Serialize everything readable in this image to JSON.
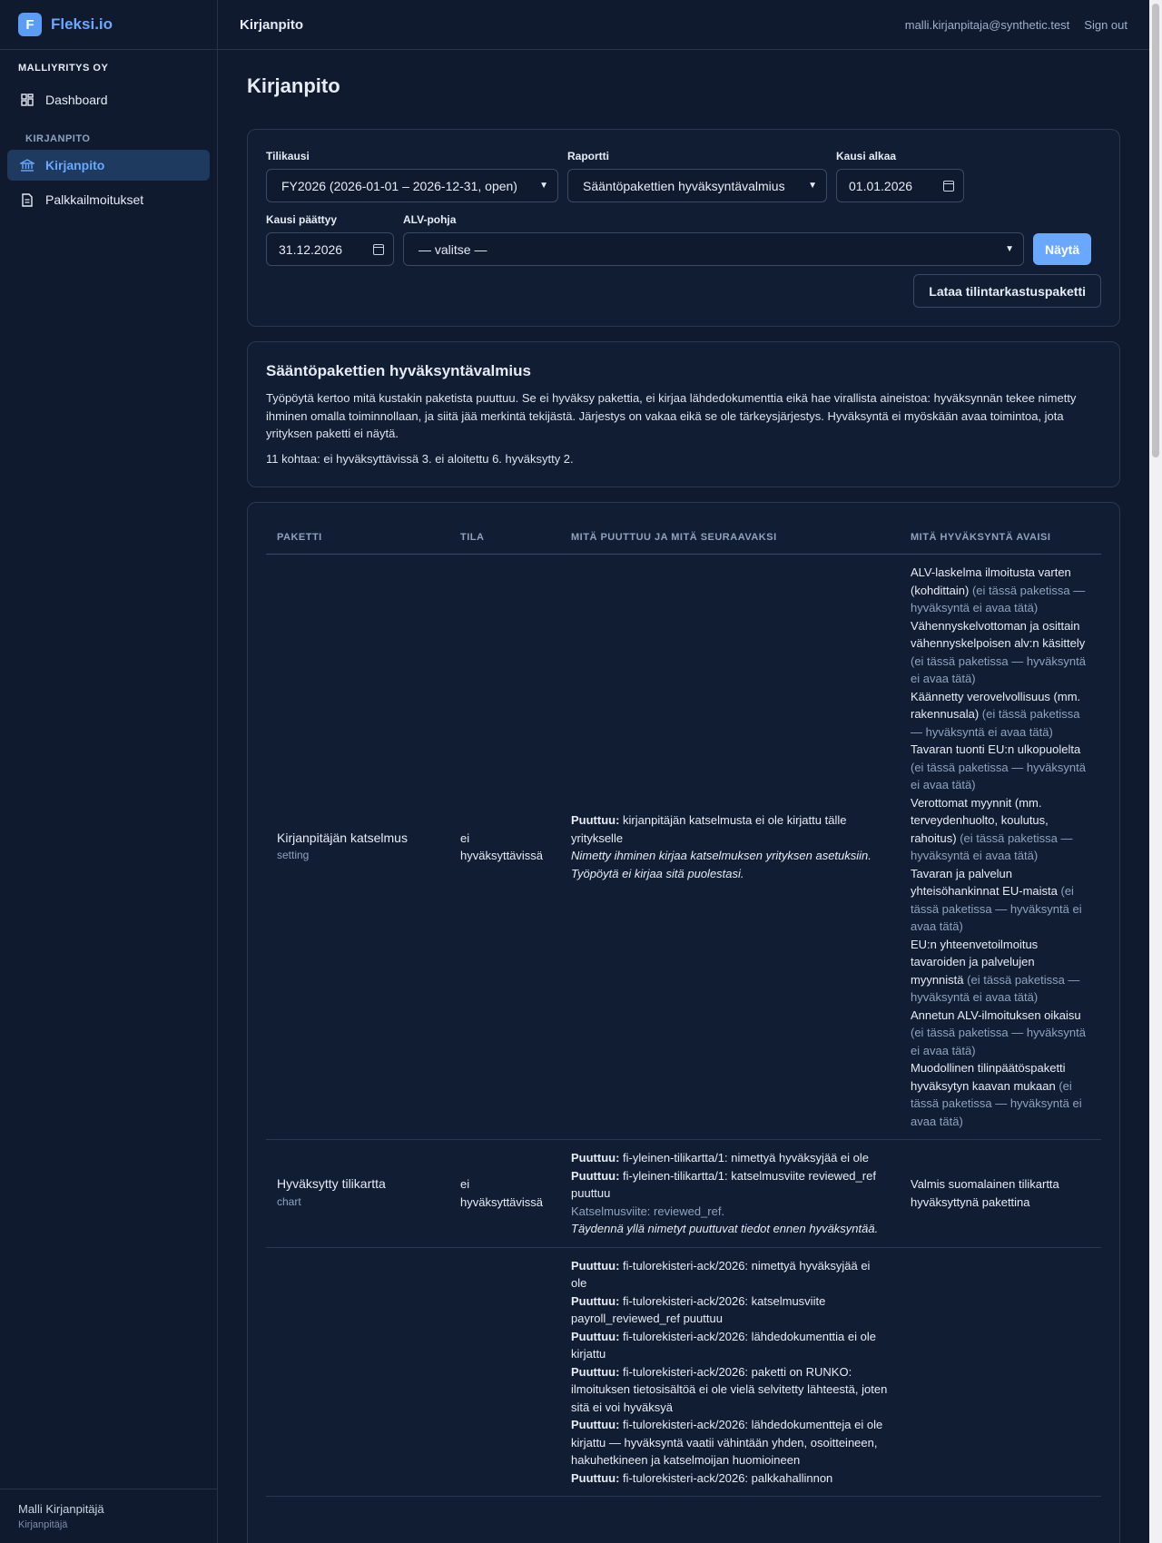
{
  "brand": {
    "logo_letter": "F",
    "name": "Fleksi.io"
  },
  "sidebar": {
    "company": "MALLIYRITYS OY",
    "dashboard_label": "Dashboard",
    "section_label": "KIRJANPITO",
    "items": [
      {
        "label": "Kirjanpito",
        "icon": "bank-icon",
        "active": true
      },
      {
        "label": "Palkkailmoitukset",
        "icon": "document-icon",
        "active": false
      }
    ],
    "user": {
      "name": "Malli Kirjanpitäjä",
      "role": "Kirjanpitäjä"
    }
  },
  "topbar": {
    "title": "Kirjanpito",
    "email": "malli.kirjanpitaja@synthetic.test",
    "signout": "Sign out"
  },
  "page": {
    "title": "Kirjanpito"
  },
  "filters": {
    "period_label": "Tilikausi",
    "period_value": "FY2026 (2026-01-01 – 2026-12-31, open)",
    "report_label": "Raportti",
    "report_value": "Sääntöpakettien hyväksyntävalmius",
    "start_label": "Kausi alkaa",
    "start_value": "01.01.2026",
    "end_label": "Kausi päättyy",
    "end_value": "31.12.2026",
    "vat_label": "ALV-pohja",
    "vat_value": "— valitse —",
    "show_button": "Näytä",
    "download_button": "Lataa tilintarkastuspaketti"
  },
  "info": {
    "title": "Sääntöpakettien hyväksyntävalmius",
    "description": "Työpöytä kertoo mitä kustakin paketista puuttuu. Se ei hyväksy pakettia, ei kirjaa lähdedokumenttia eikä hae virallista aineistoa: hyväksynnän tekee nimetty ihminen omalla toiminnollaan, ja siitä jää merkintä tekijästä. Järjestys on vakaa eikä se ole tärkeysjärjestys. Hyväksyntä ei myöskään avaa toimintoa, jota yrityksen paketti ei näytä.",
    "summary": "11 kohtaa: ei hyväksyttävissä 3. ei aloitettu 6. hyväksytty 2."
  },
  "table": {
    "headers": [
      "PAKETTI",
      "TILA",
      "MITÄ PUUTTUU JA MITÄ SEURAAVAKSI",
      "MITÄ HYVÄKSYNTÄ AVAISI"
    ],
    "missing_prefix": "Puuttuu:",
    "not_in_package": "(ei tässä paketissa — hyväksyntä ei avaa tätä)",
    "rows": [
      {
        "name": "Kirjanpitäjän katselmus",
        "kind": "setting",
        "status": "ei hyväksyttävissä",
        "missing": [
          "kirjanpitäjän katselmusta ei ole kirjattu tälle yritykselle"
        ],
        "ref": "",
        "note": "Nimetty ihminen kirjaa katselmuksen yrityksen asetuksiin. Työpöytä ei kirjaa sitä puolestasi.",
        "opens": [
          "ALV-laskelma ilmoitusta varten (kohdittain)",
          "Vähennyskelvottoman ja osittain vähennyskelpoisen alv:n käsittely",
          "Käännetty verovelvollisuus (mm. rakennusala)",
          "Tavaran tuonti EU:n ulkopuolelta",
          "Verottomat myynnit (mm. terveydenhuolto, koulutus, rahoitus)",
          "Tavaran ja palvelun yhteisöhankinnat EU-maista",
          "EU:n yhteenvetoilmoitus tavaroiden ja palvelujen myynnistä",
          "Annetun ALV-ilmoituksen oikaisu",
          "Muodollinen tilinpäätöspaketti hyväksytyn kaavan mukaan"
        ]
      },
      {
        "name": "Hyväksytty tilikartta",
        "kind": "chart",
        "status": "ei hyväksyttävissä",
        "missing": [
          "fi-yleinen-tilikartta/1: nimettyä hyväksyjää ei ole",
          "fi-yleinen-tilikartta/1: katselmusviite reviewed_ref puuttuu"
        ],
        "ref": "Katselmusviite: reviewed_ref.",
        "note": "Täydennä yllä nimetyt puuttuvat tiedot ennen hyväksyntää.",
        "opens_plain": "Valmis suomalainen tilikartta hyväksyttynä pakettina"
      },
      {
        "name": "",
        "kind": "",
        "status": "",
        "missing": [
          "fi-tulorekisteri-ack/2026: nimettyä hyväksyjää ei ole",
          "fi-tulorekisteri-ack/2026: katselmusviite payroll_reviewed_ref puuttuu",
          "fi-tulorekisteri-ack/2026: lähdedokumenttia ei ole kirjattu",
          "fi-tulorekisteri-ack/2026: paketti on RUNKO: ilmoituksen tietosisältöä ei ole vielä selvitetty lähteestä, joten sitä ei voi hyväksyä",
          "fi-tulorekisteri-ack/2026: lähdedokumentteja ei ole kirjattu — hyväksyntä vaatii vähintään yhden, osoitteineen, hakuhetkineen ja katselmoijan huomioineen",
          "fi-tulorekisteri-ack/2026: palkkahallinnon"
        ]
      }
    ]
  },
  "colors": {
    "accent": "#6aa8ff",
    "background": "#0f1a2e",
    "card": "#111d33",
    "border": "#2a3850",
    "muted": "#8fa2bd"
  }
}
